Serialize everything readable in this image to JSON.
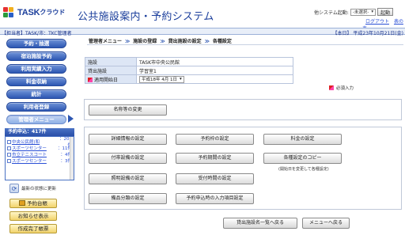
{
  "header": {
    "logo_text": "TASK",
    "logo_kana": "クラウド",
    "system_title": "公共施設案内・予約システム",
    "other_system_label": "他システム起動:",
    "other_system_value": "-未選択-",
    "boot_button": "起動",
    "links": [
      "ログアウト",
      "表の表"
    ]
  },
  "statusbar": {
    "left": "【担当者】TASK/市：TKC管理者",
    "right": "【本日】 平成23年10月21日(金)"
  },
  "sidebar": {
    "menu": [
      "予約・抽選",
      "宿泊施設予約",
      "利用実績入力",
      "料金収納",
      "統計",
      "利用者登録",
      "管理者メニュー"
    ],
    "reservations": {
      "title": "予約申込：417件",
      "items": [
        {
          "name": "中央公民館(和",
          "count": "：208件"
        },
        {
          "name": "スポーツセンター",
          "count": "：11件"
        },
        {
          "name": "市立テニスコート",
          "count": "：4件"
        },
        {
          "name": "スポーツセンター",
          "count": "：3件"
        }
      ]
    },
    "refresh_label": "最新の状態に更新",
    "bottom_buttons": [
      "予約台帳",
      "お知らせ表示",
      "作成完了帳票"
    ]
  },
  "breadcrumb": [
    "管理者メニュー",
    "施設の登録",
    "貸出施設の設定",
    "各種設定"
  ],
  "info": {
    "rows": [
      {
        "label": "施設",
        "value": "TASK市中央公民館"
      },
      {
        "label": "貸出施設",
        "value": "学習室1"
      },
      {
        "label": "適用開始日",
        "value": "平成18年 4月 1日"
      }
    ],
    "required_label": "必須入力"
  },
  "buttons": {
    "rename": "名称等の変更",
    "grid": [
      "詳細情報の設定",
      "予約枠の設定",
      "料金の設定",
      "付帯設備の設定",
      "予約期間の設定",
      "各種設定のコピー",
      "照明設備の設定",
      "受付時間の設定",
      "備品分類の設定",
      "予約申込時の入力項目設定"
    ],
    "copy_note": "(開始日を変更して各種設定)",
    "footer": [
      "貸出施設名一覧へ戻る",
      "メニューへ戻る"
    ]
  }
}
